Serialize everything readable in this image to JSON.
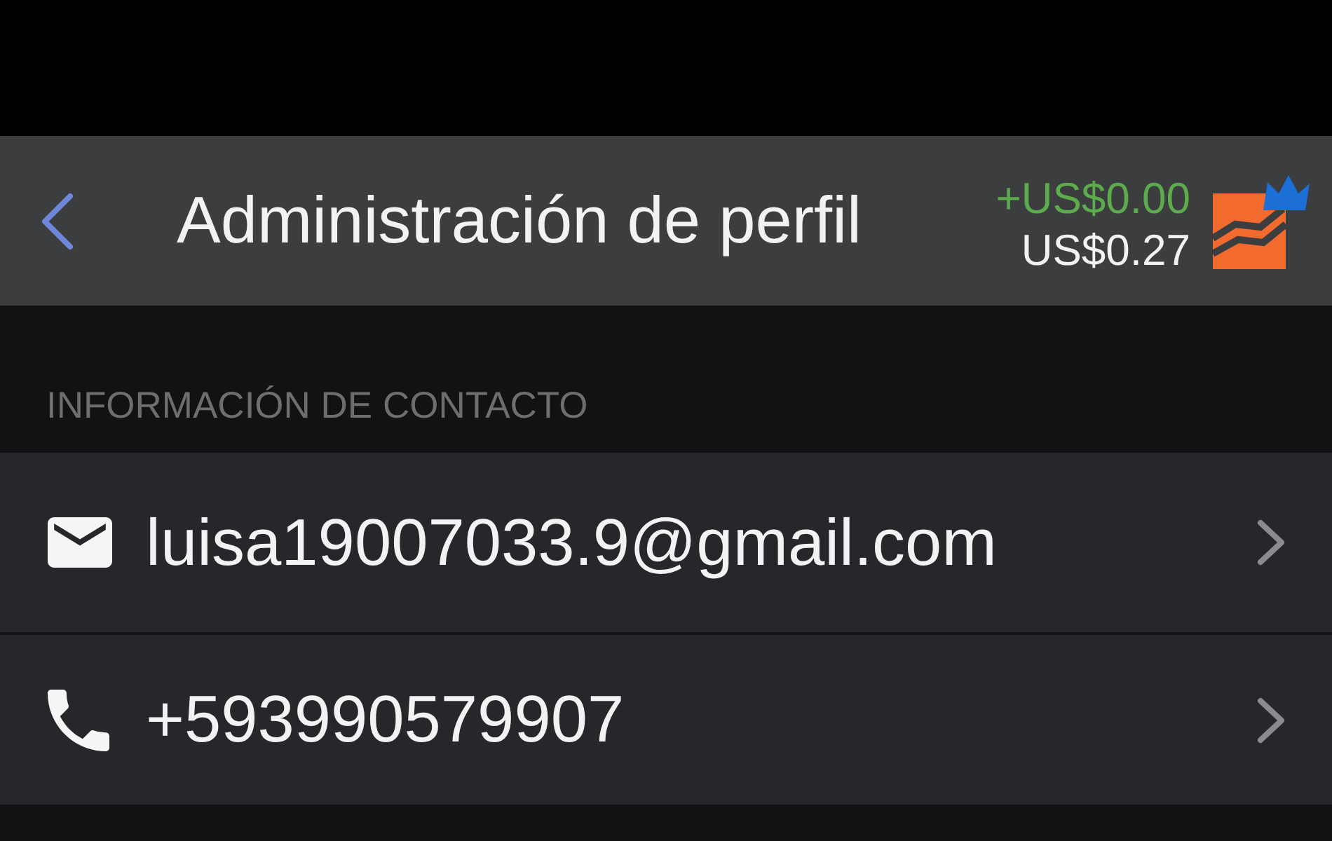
{
  "header": {
    "title": "Administración de perfil",
    "balance_change": "+US$0.00",
    "balance": "US$0.27"
  },
  "contact_section": {
    "label": "INFORMACIÓN DE CONTACTO",
    "items": [
      {
        "kind": "email",
        "value": "luisa19007033.9@gmail.com"
      },
      {
        "kind": "phone",
        "value": "+593990579907"
      }
    ]
  }
}
